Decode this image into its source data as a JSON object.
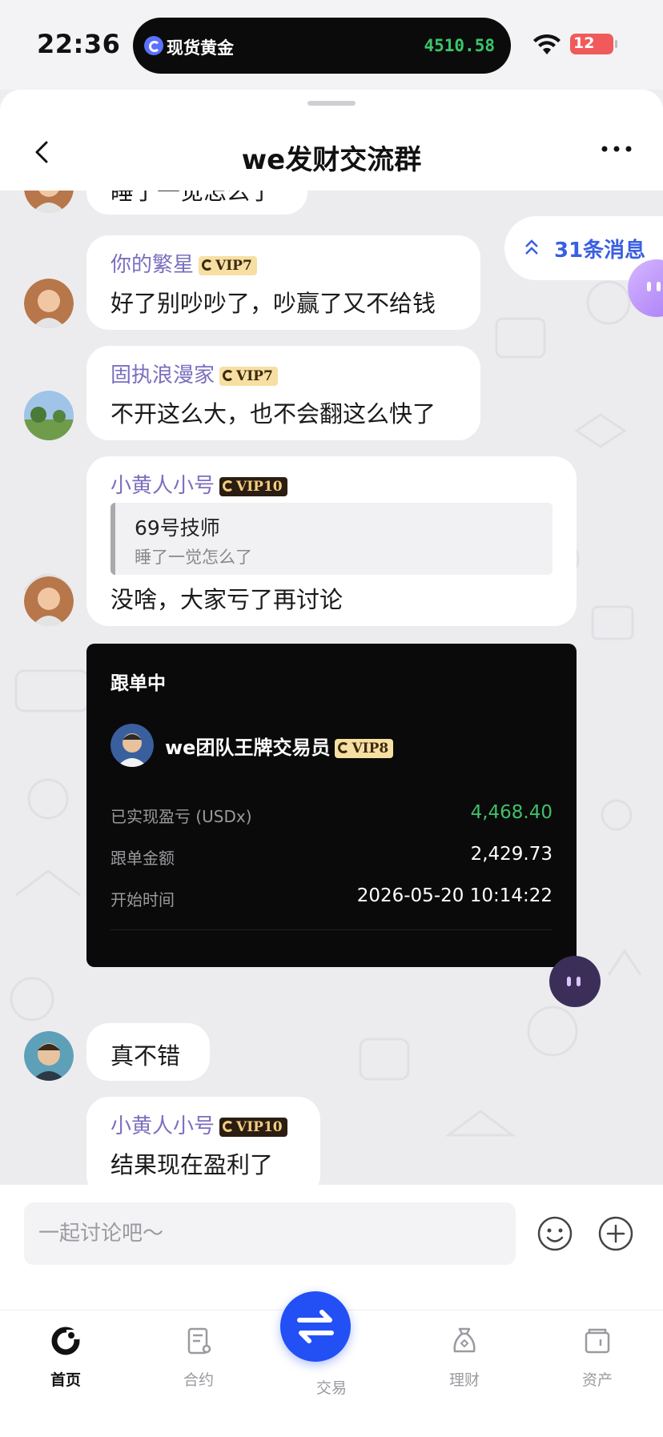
{
  "status_bar": {
    "time": "22:36",
    "island_label": "现货黄金",
    "island_price": "4510.58",
    "battery": "12"
  },
  "header": {
    "title": "we发财交流群"
  },
  "unread": {
    "label": "31条消息"
  },
  "messages": [
    {
      "text": "睡了一觉怎么了"
    },
    {
      "sender": "你的繁星",
      "vip": "VIP7",
      "text": "好了别吵吵了，吵赢了又不给钱"
    },
    {
      "sender": "固执浪漫家",
      "vip": "VIP7",
      "text": "不开这么大，也不会翻这么快了"
    },
    {
      "sender": "小黄人小号",
      "vip": "VIP10",
      "quote_name": "69号技师",
      "quote_text": "睡了一觉怎么了",
      "text": "没啥，大家亏了再讨论"
    },
    {
      "text": "真不错"
    },
    {
      "sender": "小黄人小号",
      "vip": "VIP10",
      "text": "结果现在盈利了"
    }
  ],
  "trade_card": {
    "title": "跟单中",
    "trader": "we团队王牌交易员",
    "vip": "VIP8",
    "rows": [
      {
        "label": "已实现盈亏 (USDx)",
        "value": "4,468.40"
      },
      {
        "label": "跟单金额",
        "value": "2,429.73"
      },
      {
        "label": "开始时间",
        "value": "2026-05-20 10:14:22"
      }
    ]
  },
  "input": {
    "placeholder": "一起讨论吧～"
  },
  "tabs": [
    {
      "label": "首页",
      "icon": "home-icon",
      "active": true
    },
    {
      "label": "合约",
      "icon": "contract-icon"
    },
    {
      "label": "交易",
      "icon": "swap-icon"
    },
    {
      "label": "理财",
      "icon": "wealth-icon"
    },
    {
      "label": "资产",
      "icon": "assets-icon"
    }
  ],
  "colors": {
    "accent": "#2350f5",
    "profit_green": "#3fbf6a",
    "sender_purple": "#7a6fc0",
    "unread_blue": "#3a5fe0"
  }
}
